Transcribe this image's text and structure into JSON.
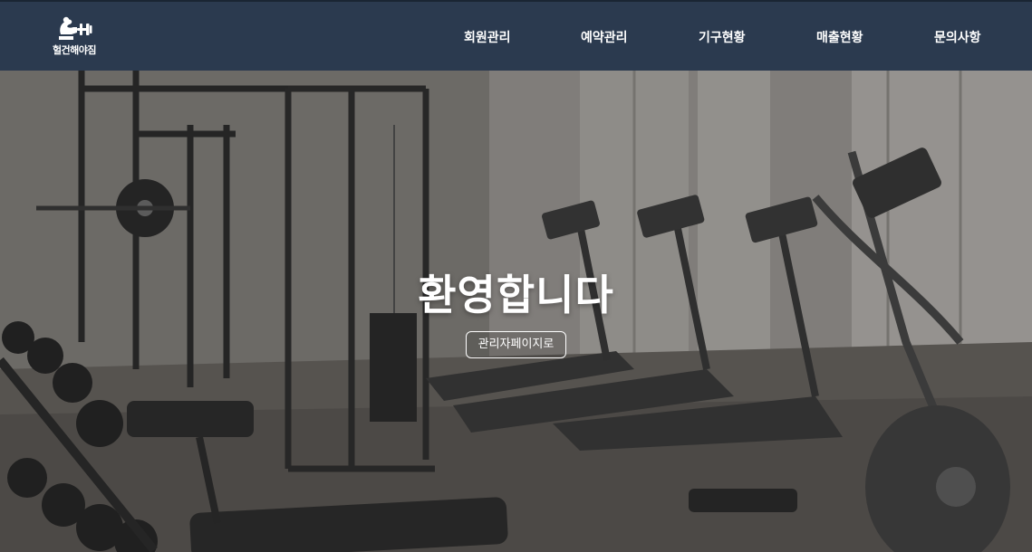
{
  "header": {
    "logo_text": "헐건해야짐",
    "logo_icon": "flexing-arm-dumbbell-icon",
    "nav": [
      {
        "label": "회원관리"
      },
      {
        "label": "예약관리"
      },
      {
        "label": "기구현황"
      },
      {
        "label": "매출현황"
      },
      {
        "label": "문의사항"
      }
    ]
  },
  "hero": {
    "title": "환영합니다",
    "admin_button_label": "관리자페이지로",
    "image": "gym-interior-with-treadmills-and-weight-rack"
  },
  "colors": {
    "header_bg": "#2b3a4f",
    "text": "#ffffff"
  }
}
